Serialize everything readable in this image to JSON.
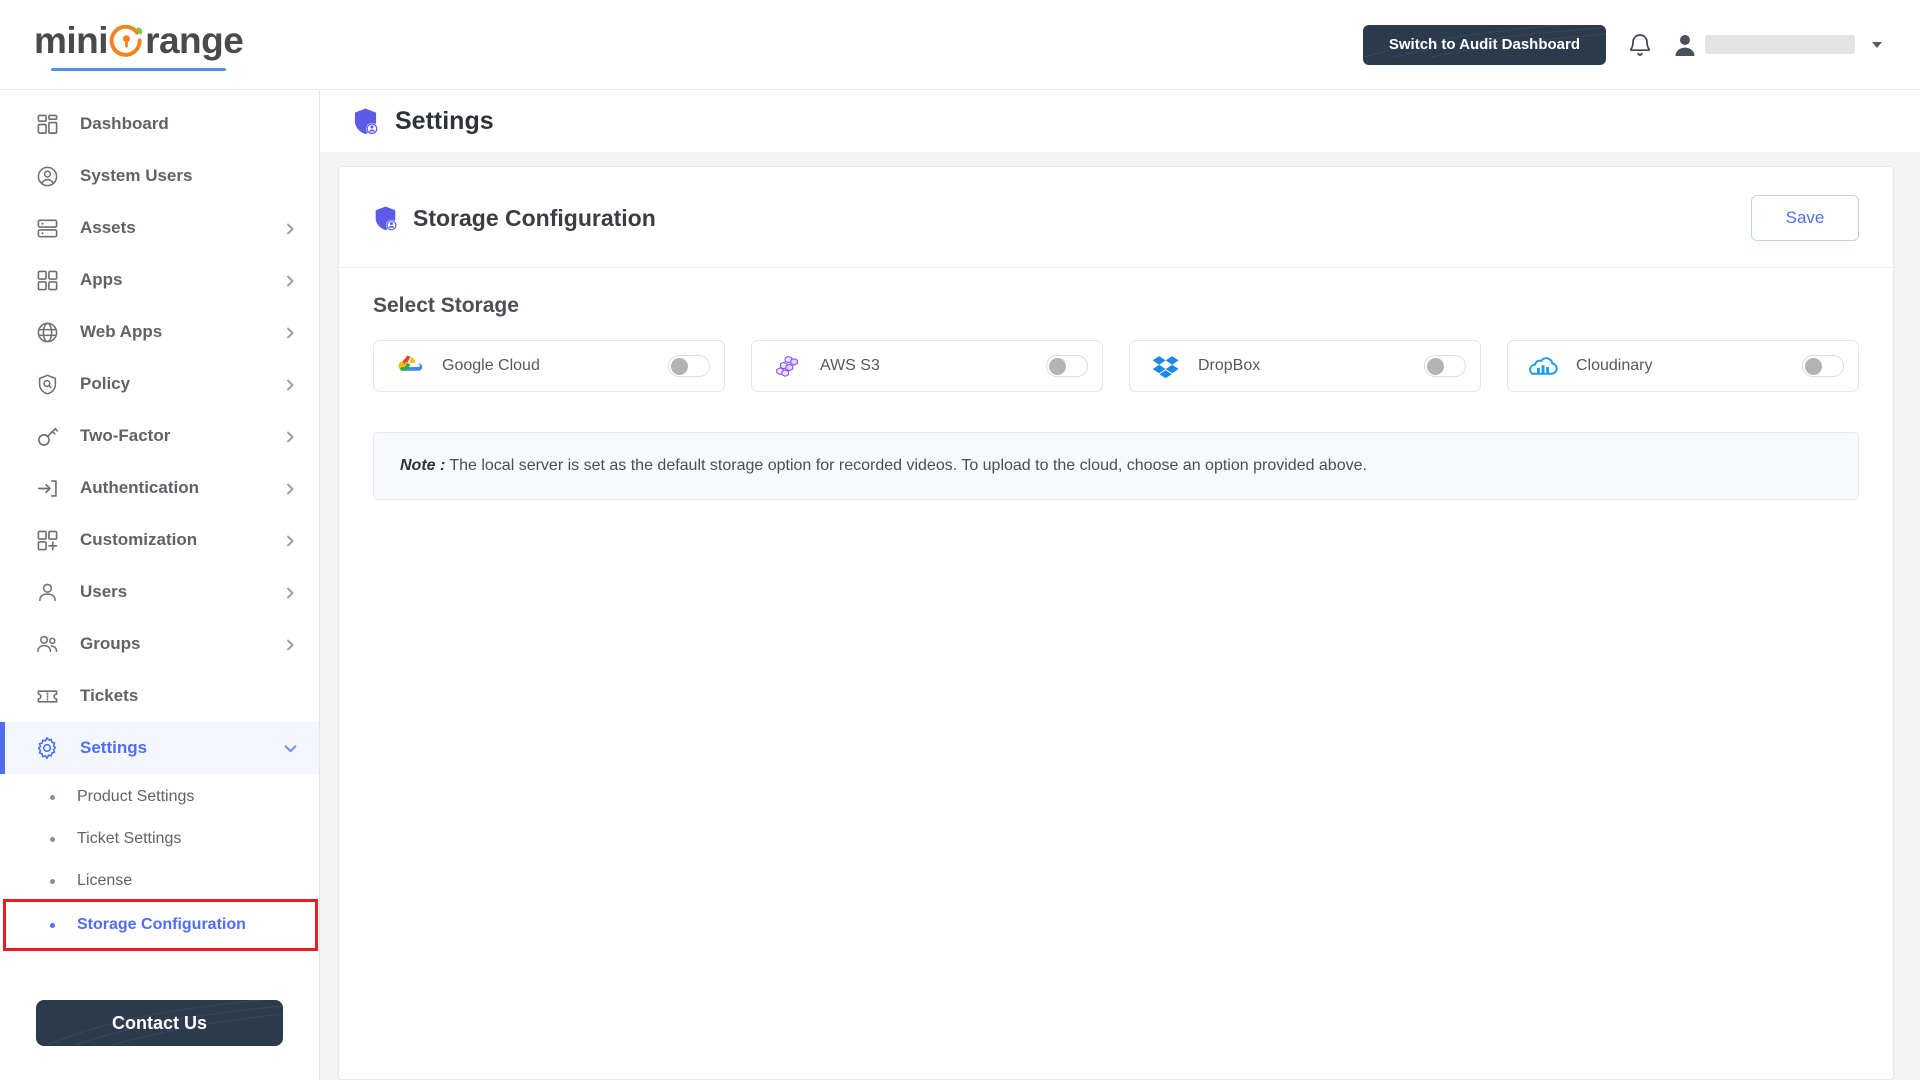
{
  "brand": {
    "name_part1": "mini",
    "name_part2": "range"
  },
  "header": {
    "audit_button": "Switch to Audit Dashboard",
    "bell_icon": "bell-icon",
    "avatar_icon": "user-avatar-icon",
    "caret_icon": "chevron-down-icon"
  },
  "sidebar": {
    "items": [
      {
        "label": "Dashboard",
        "icon": "dashboard-icon",
        "expandable": false
      },
      {
        "label": "System Users",
        "icon": "user-circle-icon",
        "expandable": false
      },
      {
        "label": "Assets",
        "icon": "server-icon",
        "expandable": true
      },
      {
        "label": "Apps",
        "icon": "grid-icon",
        "expandable": true
      },
      {
        "label": "Web Apps",
        "icon": "globe-icon",
        "expandable": true
      },
      {
        "label": "Policy",
        "icon": "shield-search-icon",
        "expandable": true
      },
      {
        "label": "Two-Factor",
        "icon": "key-icon",
        "expandable": true
      },
      {
        "label": "Authentication",
        "icon": "login-arrow-icon",
        "expandable": true
      },
      {
        "label": "Customization",
        "icon": "grid-plus-icon",
        "expandable": true
      },
      {
        "label": "Users",
        "icon": "user-icon",
        "expandable": true
      },
      {
        "label": "Groups",
        "icon": "users-group-icon",
        "expandable": true
      },
      {
        "label": "Tickets",
        "icon": "ticket-icon",
        "expandable": false
      },
      {
        "label": "Settings",
        "icon": "gear-icon",
        "expandable": true,
        "active": true,
        "expanded": true
      }
    ],
    "settings_submenu": [
      {
        "label": "Product Settings",
        "selected": false
      },
      {
        "label": "Ticket Settings",
        "selected": false
      },
      {
        "label": "License",
        "selected": false
      },
      {
        "label": "Storage Configuration",
        "selected": true,
        "highlighted": true
      }
    ],
    "contact_button": "Contact Us"
  },
  "page": {
    "title": "Settings",
    "title_icon": "shield-user-icon"
  },
  "card": {
    "title": "Storage Configuration",
    "title_icon": "shield-user-icon",
    "save_label": "Save",
    "section_title": "Select Storage",
    "storage_options": [
      {
        "label": "Google Cloud",
        "icon": "google-cloud-icon",
        "enabled": false
      },
      {
        "label": "AWS S3",
        "icon": "aws-s3-icon",
        "enabled": false
      },
      {
        "label": "DropBox",
        "icon": "dropbox-icon",
        "enabled": false
      },
      {
        "label": "Cloudinary",
        "icon": "cloudinary-icon",
        "enabled": false
      }
    ],
    "note_label": "Note :",
    "note_text": "The local server is set as the default storage option for recorded videos. To upload to the cloud, choose an option provided above."
  },
  "colors": {
    "accent_blue": "#4f6ef7",
    "dark_navy": "#2c3a4d",
    "brand_orange": "#f5821f",
    "highlight_red": "#ed1c24"
  }
}
